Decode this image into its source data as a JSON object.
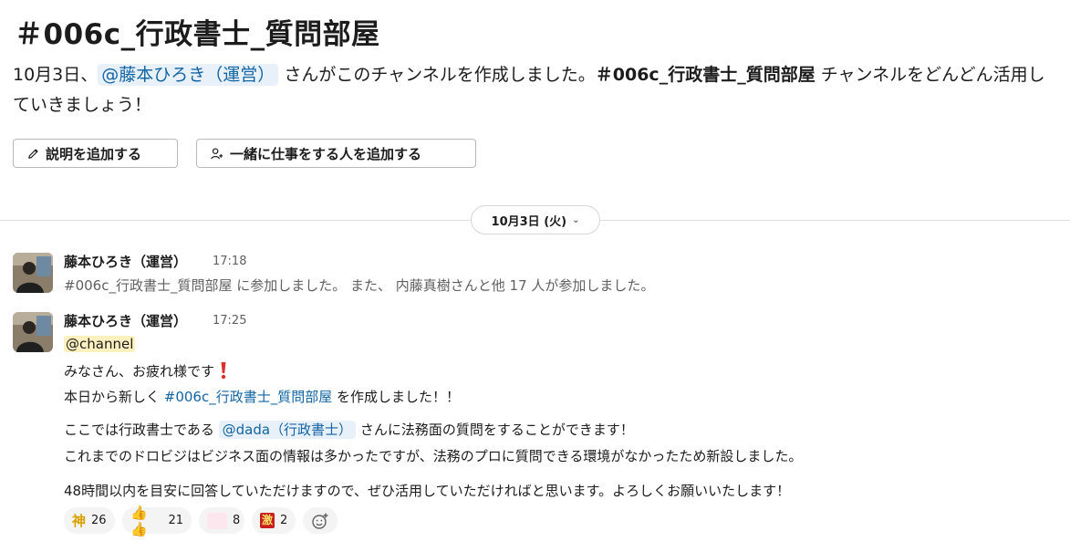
{
  "channel": {
    "title": "＃006c_行政書士_質問部屋",
    "intro_date": "10月3日、",
    "intro_creator": "@藤本ひろき（運営）",
    "intro_mid": " さんがこのチャンネルを作成しました。",
    "intro_channel": "＃006c_行政書士_質問部屋",
    "intro_end": " チャンネルをどんどん活用していきましょう！"
  },
  "buttons": {
    "add_description": "説明を追加する",
    "add_people": "一緒に仕事をする人を追加する"
  },
  "date_divider": {
    "label": "10月3日 (火)"
  },
  "messages": [
    {
      "author": "藤本ひろき（運営）",
      "time": "17:18",
      "join_text": "#006c_行政書士_質問部屋 に参加しました。 また、 内藤真樹さんと他 17 人が参加しました。"
    },
    {
      "author": "藤本ひろき（運営）",
      "time": "17:25",
      "channel_mention": "@channel",
      "line1": "みなさん、お疲れ様です",
      "line2_pre": "本日から新しく ",
      "line2_link": "#006c_行政書士_質問部屋",
      "line2_post": " を作成しました！！",
      "line3_pre": "ここでは行政書士である ",
      "line3_mention": "@dada（行政書士）",
      "line3_post": " さんに法務面の質問をすることができます！",
      "line4": "これまでのドロビジはビジネス面の情報は多かったですが、法務のプロに質問できる環境がなかったため新設しました。",
      "line5": "48時間以内を目安に回答していただけますので、ぜひ活用していただければと思います。よろしくお願いいたします！"
    }
  ],
  "reactions": [
    {
      "icon": "kami-emoji",
      "glyph": "神",
      "count": "26"
    },
    {
      "icon": "thumbs-up-emoji",
      "glyph": "👍👍",
      "count": "21"
    },
    {
      "icon": "arigatou-gozaimasu-emoji",
      "glyph": "ありがとうございます",
      "count": "8"
    },
    {
      "icon": "gekiatsu-emoji",
      "glyph": "激",
      "count": "2"
    }
  ],
  "colors": {
    "link": "#1264a3",
    "mention_bg": "#e8f1fa",
    "channel_mention_bg": "#fdf0bf",
    "exclamation": "#dd2e2e"
  }
}
